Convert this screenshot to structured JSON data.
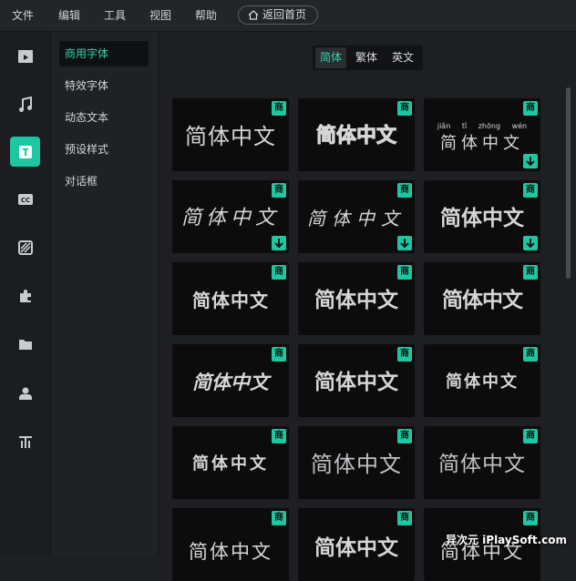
{
  "menubar": {
    "items": [
      "文件",
      "编辑",
      "工具",
      "视图",
      "帮助"
    ],
    "home_button": "返回首页"
  },
  "iconbar": {
    "icons": [
      "media-icon",
      "music-icon",
      "text-icon",
      "subtitle-cc-icon",
      "transition-icon",
      "effects-puzzle-icon",
      "folder-icon",
      "character-icon",
      "text-style-icon"
    ],
    "active": "text-icon"
  },
  "sidebar": {
    "items": [
      "商用字体",
      "特效字体",
      "动态文本",
      "预设样式",
      "对话框"
    ],
    "active_index": 0
  },
  "main": {
    "segments": [
      "简体",
      "繁体",
      "英文"
    ],
    "active_segment": 0,
    "sample_text": "简体中文",
    "pinyin": "jiǎn tǐ zhōng wén",
    "tag_label": "商",
    "accent_color": "#1ec7a1"
  },
  "watermark": "异次元 iPlaySoft.com"
}
